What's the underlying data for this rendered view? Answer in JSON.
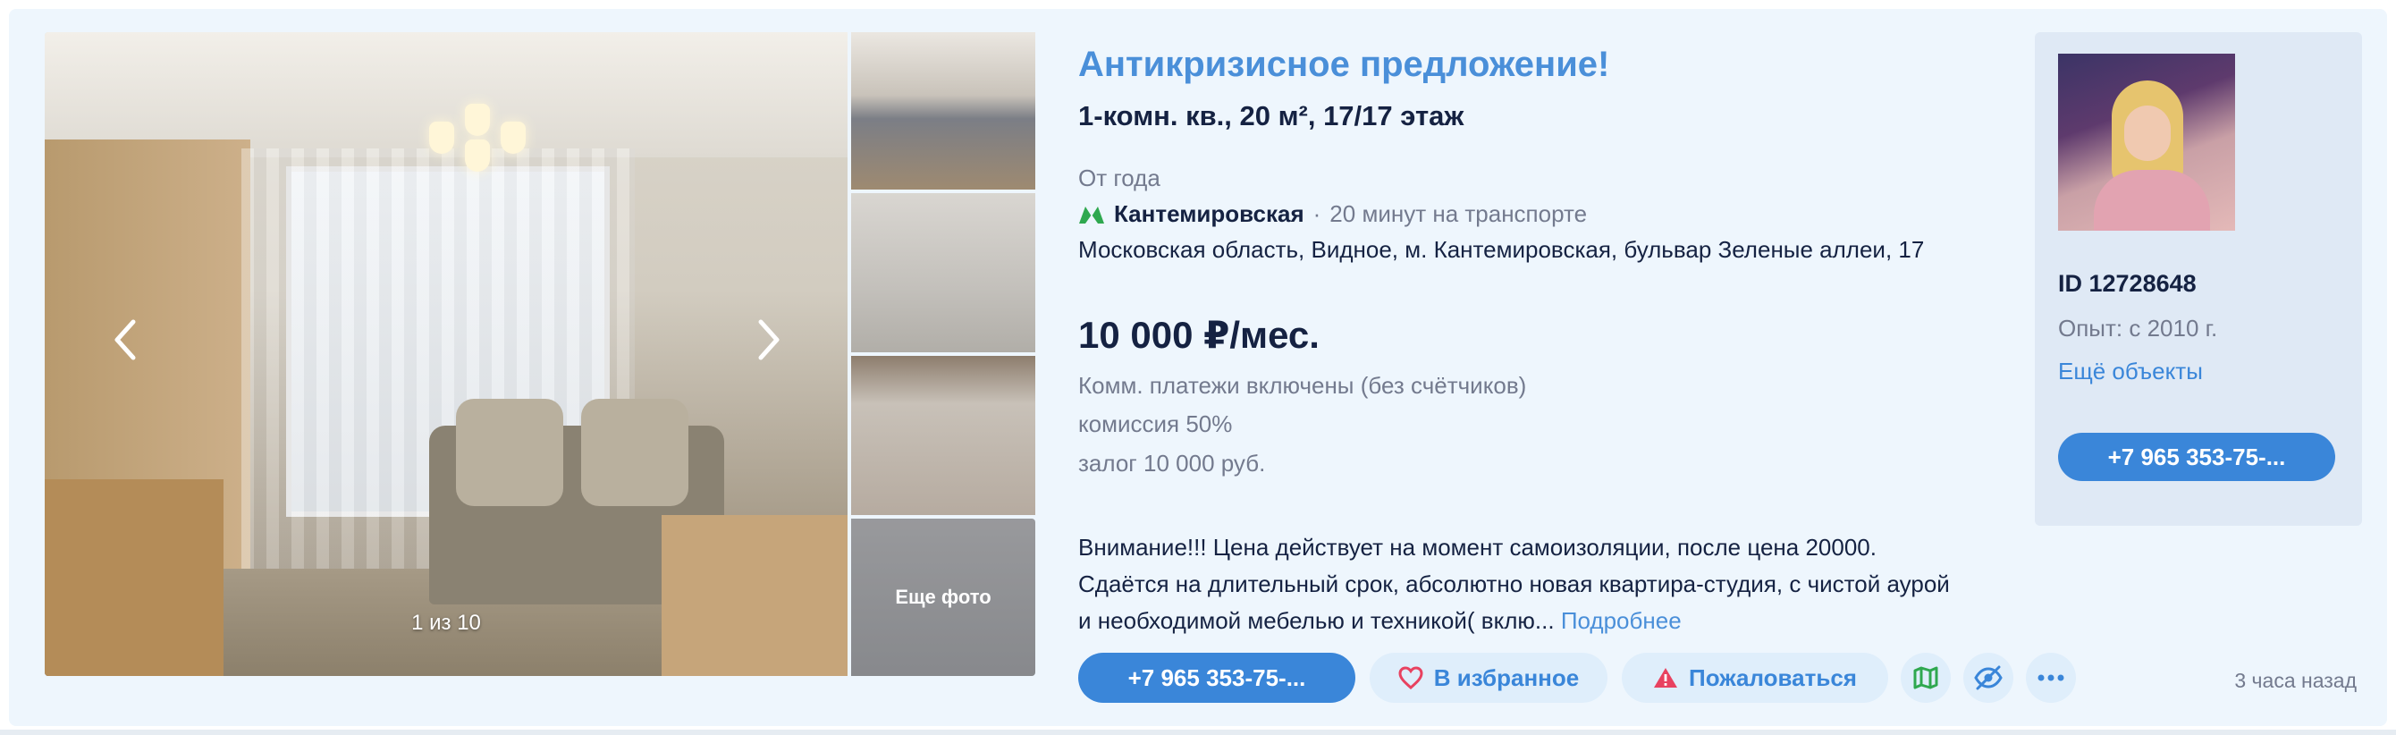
{
  "gallery": {
    "counter": "1 из 10",
    "more_photos_label": "Еще фото"
  },
  "listing": {
    "title": "Антикризисное предложение!",
    "subtitle": "1-комн. кв., 20 м², 17/17 этаж",
    "rent_term": "От года",
    "metro": {
      "station": "Кантемировская",
      "separator": "·",
      "travel": "20 минут на транспорте",
      "icon": "metro-m-icon",
      "color": "#2fa84f"
    },
    "address": "Московская область, Видное, м. Кантемировская, бульвар Зеленые аллеи, 17",
    "price": "10 000 ₽/мес.",
    "price_details": [
      "Комм. платежи включены (без счётчиков)",
      "комиссия 50%",
      "залог 10 000 руб."
    ],
    "description": "Внимание!!! Цена действует на момент самоизоляции, после цена 20000. Сдаётся на длительный срок, абсолютно новая квартира-студия, с чистой аурой и необходимой мебелью и техникой( вклю...",
    "more_link": "Подробнее",
    "time_ago": "3 часа назад"
  },
  "actions": {
    "phone": "+7 965 353-75-...",
    "favorite": "В избранное",
    "complain": "Пожаловаться",
    "icons": [
      "heart-icon",
      "warning-icon",
      "map-icon",
      "hide-icon",
      "more-icon"
    ]
  },
  "agent": {
    "id": "ID 12728648",
    "experience": "Опыт: с 2010 г.",
    "more_objects": "Ещё объекты",
    "phone": "+7 965 353-75-..."
  },
  "colors": {
    "accent": "#3a86d9",
    "title_link": "#4a8fd9",
    "card_bg": "#eef6fd",
    "warning": "#e84260"
  }
}
